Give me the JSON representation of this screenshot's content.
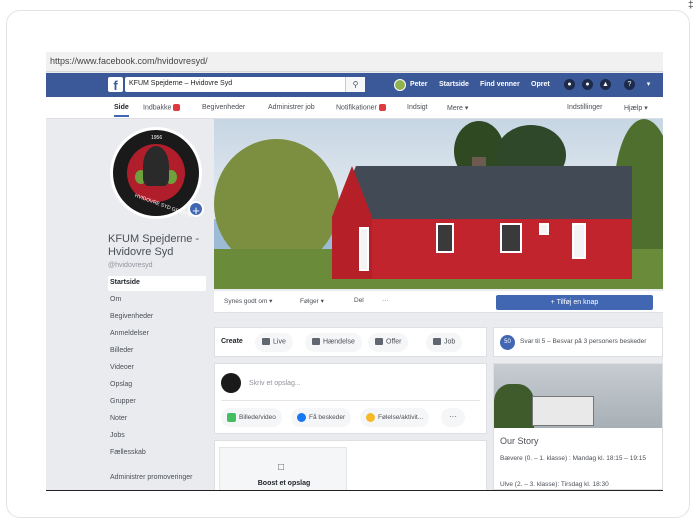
{
  "corner_mark": "‡",
  "browser": {
    "url": "https://www.facebook.com/hvidovresyd/"
  },
  "fb_header": {
    "logo": "f",
    "search_value": "KFUM Spejderne – Hvidovre Syd",
    "search_icon": "search-icon",
    "links": [
      "Peter",
      "Startside",
      "Find venner",
      "Opret"
    ],
    "help_icon": "?",
    "menu_icon": "▾"
  },
  "subnav": {
    "tabs": [
      "Side",
      "Indbakke",
      "Begivenheder",
      "Administrer job",
      "Notifikationer",
      "Indsigt",
      "Mere ▾"
    ],
    "right": [
      "Indstillinger",
      "Hjælp ▾"
    ]
  },
  "profile": {
    "year": "1956",
    "ring_text": "HVIDOVRE SYD GRUPPE",
    "name": "KFUM Spejderne - Hvidovre Syd",
    "handle": "@hvidovresyd",
    "plus": "+"
  },
  "sidebar": {
    "items": [
      "Startside",
      "Om",
      "Begivenheder",
      "Anmeldelser",
      "Billeder",
      "Videoer",
      "Opslag",
      "Grupper",
      "Noter",
      "Jobs",
      "Fællesskab"
    ],
    "footer": "Administrer promoveringer"
  },
  "actions": {
    "liked": "Synes godt om ▾",
    "following": "Følger ▾",
    "share": "Del",
    "more": "···",
    "cta": "+ Tilføj en knap"
  },
  "create": {
    "label": "Create",
    "buttons": [
      "Live",
      "Hændelse",
      "Offer",
      "Job"
    ]
  },
  "post": {
    "placeholder": "Skriv et opslag...",
    "buttons": [
      "Billede/video",
      "Få beskeder",
      "Følelse/aktivit..."
    ],
    "more": "···"
  },
  "feed": {
    "boost_label": "Boost et opslag",
    "boost_icon": "thumb-icon"
  },
  "right": {
    "icon_text": "50",
    "notice": "Svar til 5 – Besvar på 3 personers beskeder",
    "story_title": "Our Story",
    "story_lines": [
      "Bævere (0. – 1. klasse) : Mandag kl. 18:15 – 19:15",
      "Ulve (2. – 3. klasse): Tirsdag kl. 18:30"
    ]
  }
}
